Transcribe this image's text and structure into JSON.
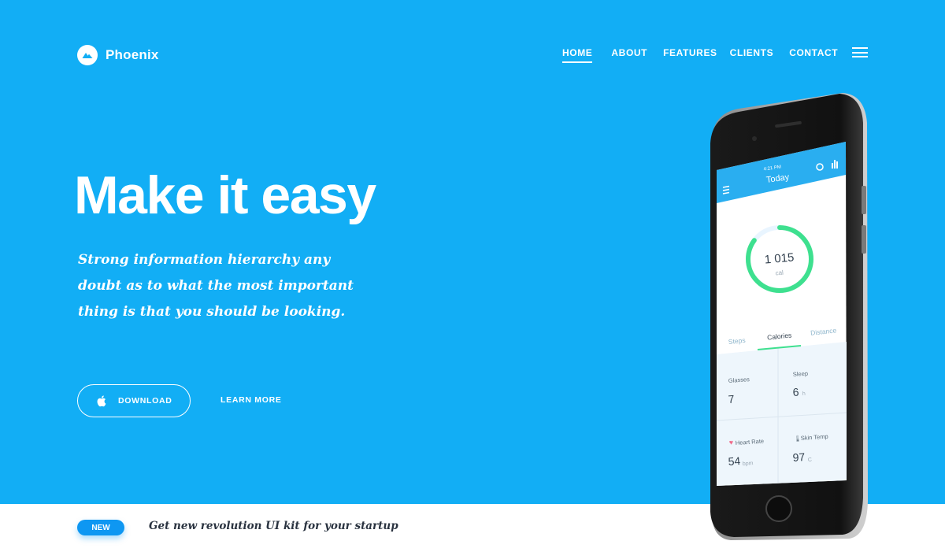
{
  "brand": {
    "name": "Phoenix",
    "logo_icon": "mountain-icon"
  },
  "nav": {
    "items": [
      {
        "label": "HOME",
        "active": true
      },
      {
        "label": "ABOUT",
        "active": false
      },
      {
        "label": "FEATURES",
        "active": false
      },
      {
        "label": "CLIENTS",
        "active": false
      },
      {
        "label": "CONTACT",
        "active": false
      }
    ],
    "menu_icon": "hamburger-icon"
  },
  "hero": {
    "headline": "Make it easy",
    "subline": "Strong information hierarchy any doubt as to what the most important thing is that you should be looking.",
    "download_label": "DOWNLOAD",
    "download_icon": "apple-icon",
    "learn_more_label": "LEARN MORE"
  },
  "announcement": {
    "badge": "NEW",
    "text": "Get new revolution UI kit for your startup"
  },
  "phone_app": {
    "status_time": "4:21 PM",
    "title": "Today",
    "calories_value": "1 015",
    "calories_unit": "cal",
    "calories_progress": 0.85,
    "tabs": [
      "Steps",
      "Calories",
      "Distance"
    ],
    "active_tab": "Calories",
    "stats": [
      {
        "label": "Glasses",
        "value": "7",
        "unit": ""
      },
      {
        "label": "Sleep",
        "value": "6",
        "unit": "h"
      },
      {
        "label": "Heart Rate",
        "value": "54",
        "unit": "bpm"
      },
      {
        "label": "Skin Temp",
        "value": "97",
        "unit": "C"
      }
    ]
  },
  "colors": {
    "hero_bg": "#12aef5",
    "badge_bg": "#0e97f2",
    "ring_green": "#3ee08f",
    "app_header": "#2aaef0"
  }
}
